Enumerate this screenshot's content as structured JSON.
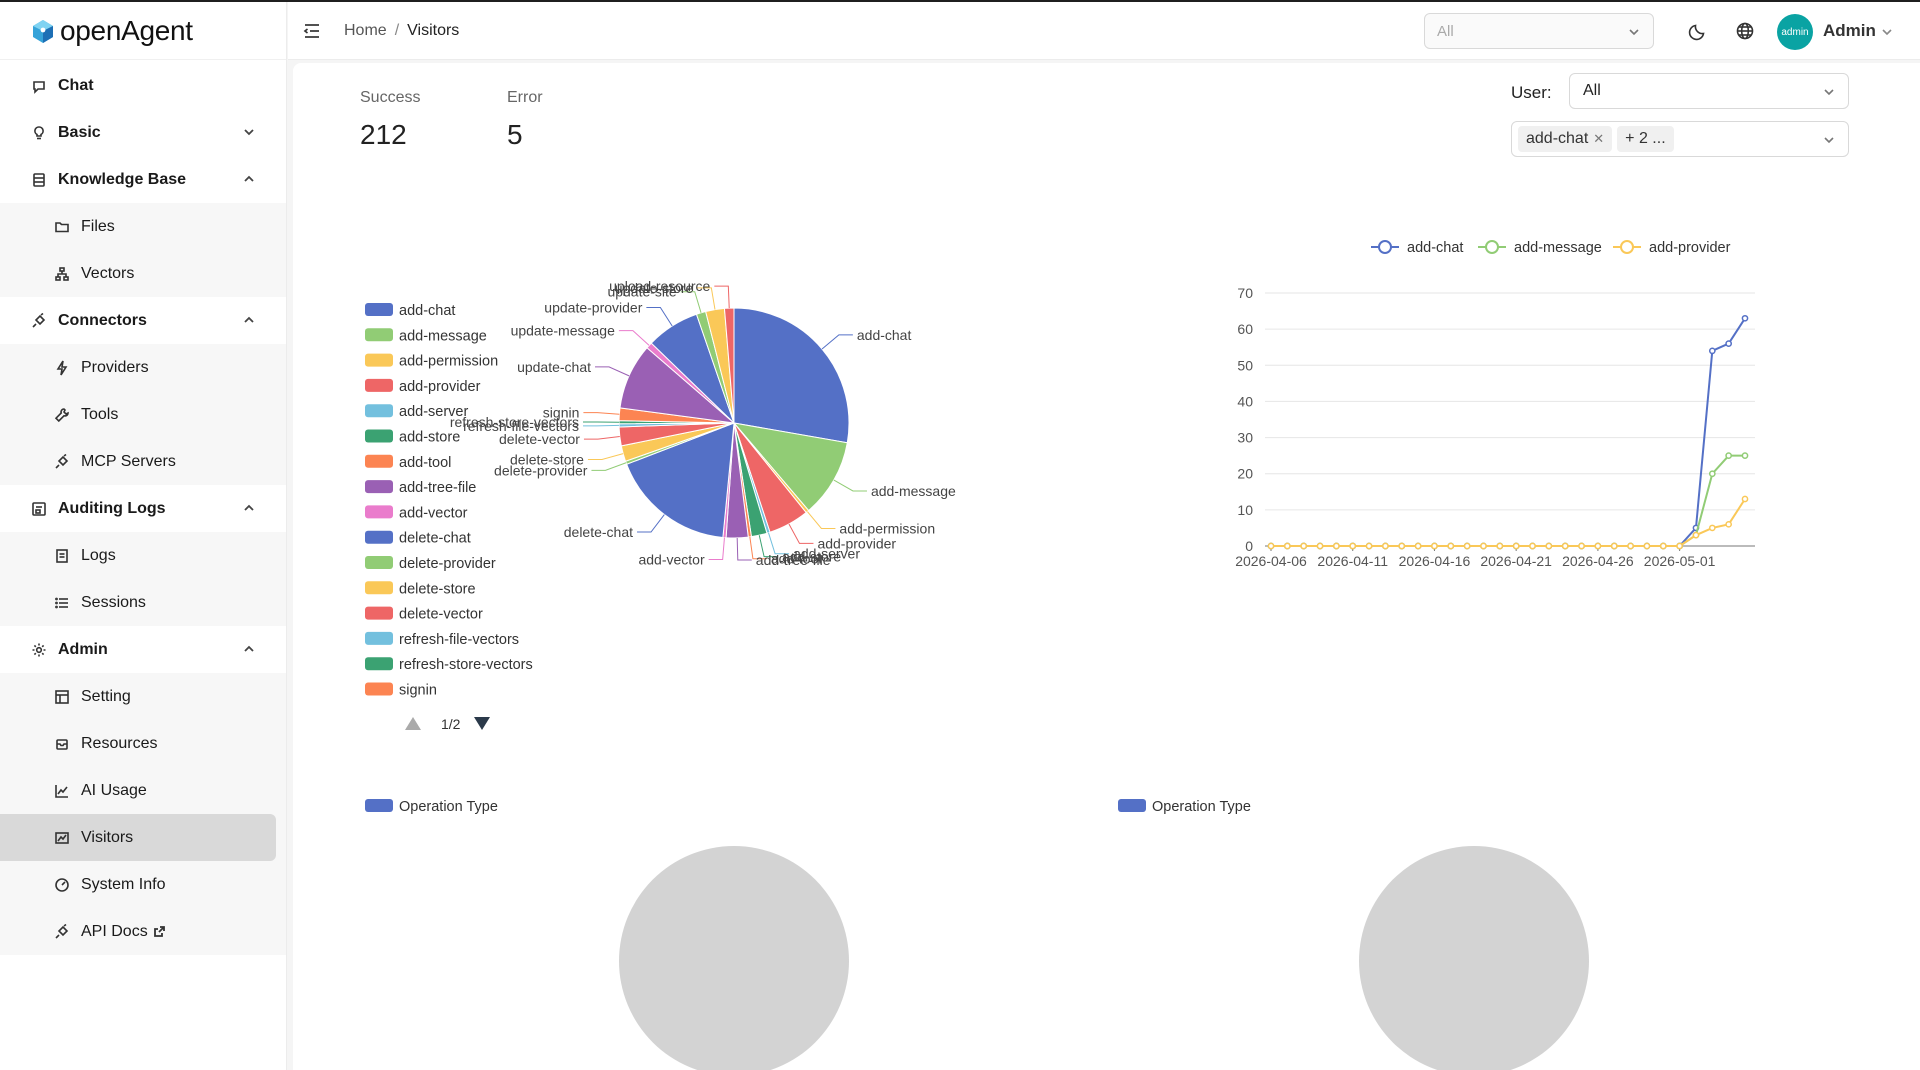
{
  "app": {
    "name": "openAgent"
  },
  "sidebar": {
    "items": [
      {
        "label": "Chat",
        "icon": "chat-icon",
        "level": "top"
      },
      {
        "label": "Basic",
        "icon": "bulb-icon",
        "level": "top",
        "chevron": "down"
      },
      {
        "label": "Knowledge Base",
        "icon": "database-icon",
        "level": "top",
        "chevron": "up"
      },
      {
        "label": "Files",
        "icon": "folder-icon",
        "level": "sub"
      },
      {
        "label": "Vectors",
        "icon": "network-icon",
        "level": "sub"
      },
      {
        "label": "Connectors",
        "icon": "plug-icon",
        "level": "top",
        "chevron": "up"
      },
      {
        "label": "Providers",
        "icon": "bolt-icon",
        "level": "sub"
      },
      {
        "label": "Tools",
        "icon": "wrench-icon",
        "level": "sub"
      },
      {
        "label": "MCP Servers",
        "icon": "plug-icon",
        "level": "sub"
      },
      {
        "label": "Auditing Logs",
        "icon": "audit-icon",
        "level": "top",
        "chevron": "up"
      },
      {
        "label": "Logs",
        "icon": "document-icon",
        "level": "sub"
      },
      {
        "label": "Sessions",
        "icon": "list-icon",
        "level": "sub"
      },
      {
        "label": "Admin",
        "icon": "gear-icon",
        "level": "top",
        "chevron": "up"
      },
      {
        "label": "Setting",
        "icon": "layout-icon",
        "level": "sub"
      },
      {
        "label": "Resources",
        "icon": "box-icon",
        "level": "sub"
      },
      {
        "label": "AI Usage",
        "icon": "line-chart-icon",
        "level": "sub"
      },
      {
        "label": "Visitors",
        "icon": "area-chart-icon",
        "level": "sub",
        "active": true
      },
      {
        "label": "System Info",
        "icon": "dashboard-icon",
        "level": "sub"
      },
      {
        "label": "API Docs",
        "icon": "plug-icon",
        "level": "sub",
        "external": true
      }
    ]
  },
  "header": {
    "breadcrumb": [
      "Home",
      "Visitors"
    ],
    "breadcrumb_sep": "/",
    "store_select": "All",
    "avatar_text": "admin",
    "user_name": "Admin"
  },
  "stats": [
    {
      "label": "Success",
      "value": "212"
    },
    {
      "label": "Error",
      "value": "5"
    }
  ],
  "filters": {
    "user_label": "User:",
    "user_value": "All",
    "tags": [
      "add-chat",
      "+ 2 ..."
    ]
  },
  "colors": {
    "blue": "#5470c6",
    "green": "#91cc75",
    "yellow": "#fac858",
    "red": "#ee6666",
    "cyan": "#73c0de",
    "teal": "#3ba272",
    "orange": "#fc8452",
    "purple": "#9a60b4",
    "pink": "#ea7ccc",
    "empty": "#d3d3d3",
    "accent": "#0aa3a3"
  },
  "chart_data": [
    {
      "type": "pie",
      "legend": {
        "entries": [
          "add-chat",
          "add-message",
          "add-permission",
          "add-provider",
          "add-server",
          "add-store",
          "add-tool",
          "add-tree-file",
          "add-vector",
          "delete-chat",
          "delete-provider",
          "delete-store",
          "delete-vector",
          "refresh-file-vectors",
          "refresh-store-vectors",
          "signin"
        ],
        "page": "1/2",
        "placement": "left"
      },
      "slices": [
        {
          "name": "add-chat",
          "value": 63
        },
        {
          "name": "add-message",
          "value": 25
        },
        {
          "name": "add-permission",
          "value": 1
        },
        {
          "name": "add-provider",
          "value": 13
        },
        {
          "name": "add-server",
          "value": 1
        },
        {
          "name": "add-store",
          "value": 5
        },
        {
          "name": "add-tool",
          "value": 1
        },
        {
          "name": "add-tree-file",
          "value": 7
        },
        {
          "name": "add-vector",
          "value": 1
        },
        {
          "name": "delete-chat",
          "value": 40
        },
        {
          "name": "delete-provider",
          "value": 1
        },
        {
          "name": "delete-store",
          "value": 5
        },
        {
          "name": "delete-vector",
          "value": 6
        },
        {
          "name": "refresh-file-vectors",
          "value": 1
        },
        {
          "name": "refresh-store-vectors",
          "value": 1
        },
        {
          "name": "signin",
          "value": 4
        },
        {
          "name": "update-chat",
          "value": 21
        },
        {
          "name": "update-message",
          "value": 2
        },
        {
          "name": "update-provider",
          "value": 17
        },
        {
          "name": "update-site",
          "value": 3
        },
        {
          "name": "update-store",
          "value": 6
        },
        {
          "name": "upload-resource",
          "value": 3
        }
      ]
    },
    {
      "type": "line",
      "x": [
        "2026-04-06",
        "2026-04-07",
        "2026-04-08",
        "2026-04-09",
        "2026-04-10",
        "2026-04-11",
        "2026-04-12",
        "2026-04-13",
        "2026-04-14",
        "2026-04-15",
        "2026-04-16",
        "2026-04-17",
        "2026-04-18",
        "2026-04-19",
        "2026-04-20",
        "2026-04-21",
        "2026-04-22",
        "2026-04-23",
        "2026-04-24",
        "2026-04-25",
        "2026-04-26",
        "2026-04-27",
        "2026-04-28",
        "2026-04-29",
        "2026-04-30",
        "2026-05-01",
        "2026-05-02",
        "2026-05-03",
        "2026-05-04",
        "2026-05-05"
      ],
      "xticks": [
        "2026-04-06",
        "2026-04-11",
        "2026-04-16",
        "2026-04-21",
        "2026-04-26",
        "2026-05-01"
      ],
      "yticks": [
        0,
        10,
        20,
        30,
        40,
        50,
        60,
        70
      ],
      "ylim": [
        0,
        70
      ],
      "grid": true,
      "legend_placement": "top",
      "series": [
        {
          "name": "add-chat",
          "values": [
            0,
            0,
            0,
            0,
            0,
            0,
            0,
            0,
            0,
            0,
            0,
            0,
            0,
            0,
            0,
            0,
            0,
            0,
            0,
            0,
            0,
            0,
            0,
            0,
            0,
            0,
            5,
            54,
            56,
            63
          ]
        },
        {
          "name": "add-message",
          "values": [
            0,
            0,
            0,
            0,
            0,
            0,
            0,
            0,
            0,
            0,
            0,
            0,
            0,
            0,
            0,
            0,
            0,
            0,
            0,
            0,
            0,
            0,
            0,
            0,
            0,
            0,
            3,
            20,
            25,
            25
          ]
        },
        {
          "name": "add-provider",
          "values": [
            0,
            0,
            0,
            0,
            0,
            0,
            0,
            0,
            0,
            0,
            0,
            0,
            0,
            0,
            0,
            0,
            0,
            0,
            0,
            0,
            0,
            0,
            0,
            0,
            0,
            0,
            3,
            5,
            6,
            13
          ]
        }
      ]
    },
    {
      "type": "pie",
      "legend": {
        "entries": [
          "Operation Type"
        ]
      },
      "slices": []
    },
    {
      "type": "pie",
      "legend": {
        "entries": [
          "Operation Type"
        ]
      },
      "slices": []
    }
  ]
}
